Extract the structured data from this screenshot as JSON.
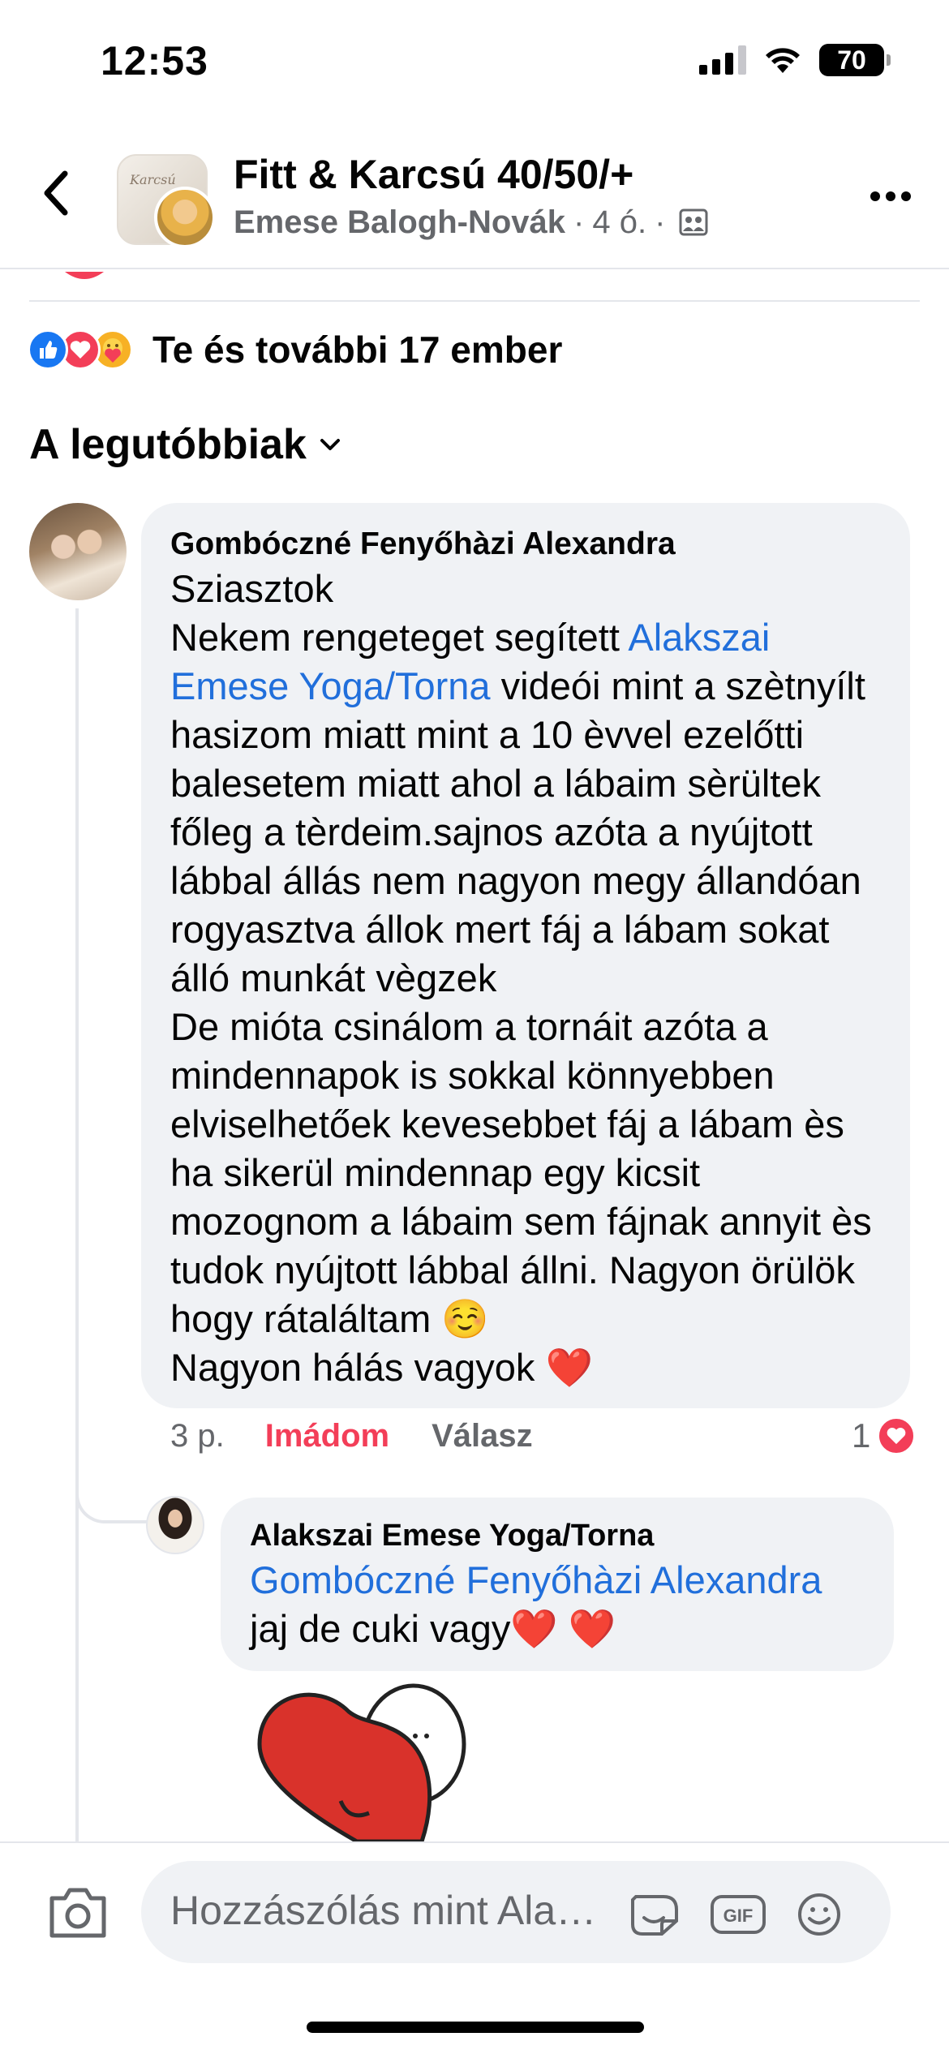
{
  "status_bar": {
    "time": "12:53",
    "battery": "70"
  },
  "header": {
    "group_title": "Fitt & Karcsú 40/50/+",
    "author": "Emese Balogh-Novák",
    "time_ago": "4 ó.",
    "separator": "·",
    "thumb_text": "Karcsú"
  },
  "reactions": {
    "text": "Te és további 17 ember"
  },
  "sort": {
    "label": "A legutóbbiak"
  },
  "comment": {
    "author": "Gombóczné Fenyőhàzi Alexandra",
    "text_before_link": "Sziasztok\nNekem rengeteget segített ",
    "link": "Alakszai Emese Yoga/Torna",
    "text_after_link": " videói mint a szètnyílt hasizom miatt mint a 10 èvvel ezelőtti balesetem miatt ahol a lábaim sèrültek főleg a tèrdeim.sajnos azóta a nyújtott lábbal állás nem nagyon megy állandóan rogyasztva állok mert fáj a lábam sokat álló munkát vègzek\nDe mióta csinálom a tornáit azóta a mindennapok is sokkal könnyebben elviselhetőek kevesebbet fáj a lábam ès ha sikerül mindennap egy kicsit mozognom a lábaim sem fájnak annyit ès tudok nyújtott lábbal állni. Nagyon örülök hogy rátaláltam ☺️\nNagyon hálás vagyok ❤️",
    "time_ago": "3 p.",
    "reaction_label": "Imádom",
    "reply_label": "Válasz",
    "reaction_count": "1"
  },
  "reply": {
    "author": "Alakszai Emese Yoga/Torna",
    "mention": "Gombóczné Fenyőhàzi Alexandra",
    "text": "jaj de cuki vagy❤️ ❤️"
  },
  "composer": {
    "placeholder": "Hozzászólás mint Ala…"
  },
  "icons": {
    "back": "back-chevron-icon",
    "more": "more-dots-icon",
    "audience": "group-audience-icon",
    "camera": "camera-icon",
    "sticker": "sticker-icon",
    "gif": "gif-icon",
    "emoji": "emoji-icon"
  },
  "colors": {
    "link": "#216fdb",
    "love": "#f33e58",
    "like": "#1877f2",
    "bubble": "#f0f2f5",
    "muted": "#65676b"
  }
}
